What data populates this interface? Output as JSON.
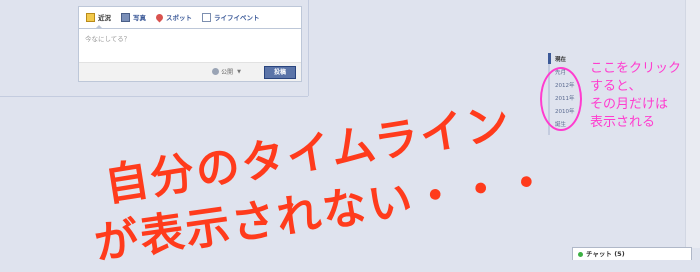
{
  "composer": {
    "tabs": [
      {
        "label": "近況",
        "icon": "status-icon"
      },
      {
        "label": "写真",
        "icon": "photo-icon"
      },
      {
        "label": "スポット",
        "icon": "place-icon"
      },
      {
        "label": "ライフイベント",
        "icon": "life-event-icon"
      }
    ],
    "placeholder": "今なにしてる？",
    "privacy_label": "公開",
    "post_label": "投稿"
  },
  "timeline_nav": {
    "items": [
      "現在",
      "先月",
      "2012年",
      "2011年",
      "2010年",
      "誕生"
    ]
  },
  "annotations": {
    "note_lines": [
      "ここをクリック",
      "すると、",
      "その月だけは",
      "表示される"
    ],
    "headline_lines": [
      "自分のタイムライン",
      "が表示されない・・・"
    ],
    "note_color": "#ff3ccf",
    "headline_color": "#ff3b1c"
  },
  "chat": {
    "label": "チャット (5)"
  },
  "colors": {
    "page_bg": "#dfe3ee",
    "brand_blue": "#3b5998"
  }
}
